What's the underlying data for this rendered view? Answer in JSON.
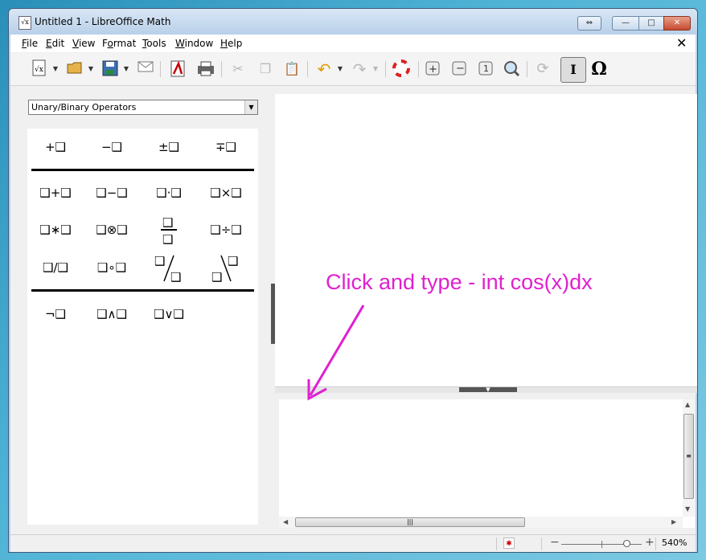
{
  "window": {
    "title": "Untitled 1 - LibreOffice Math",
    "app_icon": "√x",
    "caption_buttons": {
      "restore_app": "⇔",
      "minimize": "—",
      "maximize": "□",
      "close": "✕"
    }
  },
  "menubar": {
    "items": [
      {
        "key": "F",
        "rest": "ile"
      },
      {
        "key": "E",
        "rest": "dit"
      },
      {
        "key": "V",
        "rest": "iew"
      },
      {
        "key": "",
        "pre": "F",
        "key2": "o",
        "rest": "rmat"
      },
      {
        "key": "T",
        "rest": "ools"
      },
      {
        "key": "W",
        "rest": "indow"
      },
      {
        "key": "H",
        "rest": "elp"
      }
    ],
    "close_document": "✕"
  },
  "toolbar": {
    "icons": [
      "new-document-icon",
      "open-icon",
      "save-icon",
      "email-icon",
      "pdf-export-icon",
      "print-icon",
      "cut-icon",
      "copy-icon",
      "paste-icon",
      "undo-icon",
      "redo-icon",
      "help-lifebuoy-icon",
      "zoom-in-icon",
      "zoom-out-icon",
      "zoom-100-icon",
      "show-all-icon",
      "update-icon",
      "formula-cursor-icon",
      "symbols-omega-icon"
    ],
    "symbols_label": "Ω",
    "cursor_label": "I"
  },
  "elements": {
    "category": "Unary/Binary Operators",
    "unary": [
      "+❑",
      "−❑",
      "±❑",
      "∓❑"
    ],
    "binary_row1": [
      "❑+❑",
      "❑−❑",
      "❑·❑",
      "❑×❑"
    ],
    "binary_row2": [
      "❑∗❑",
      "❑⊗❑",
      "fraction",
      "❑÷❑"
    ],
    "binary_row3": [
      "❑/❑",
      "❑∘❑",
      "wide-slash",
      "wide-backslash"
    ],
    "logic": [
      "¬❑",
      "❑∧❑",
      "❑∨❑"
    ],
    "box": "❑"
  },
  "command": {
    "value": ""
  },
  "annotation": {
    "text": "Click and type - int cos(x)dx",
    "color": "#e020d0"
  },
  "statusbar": {
    "modified": "✱",
    "zoom_value": "540%",
    "zoom_minus": "−",
    "zoom_plus": "+"
  }
}
